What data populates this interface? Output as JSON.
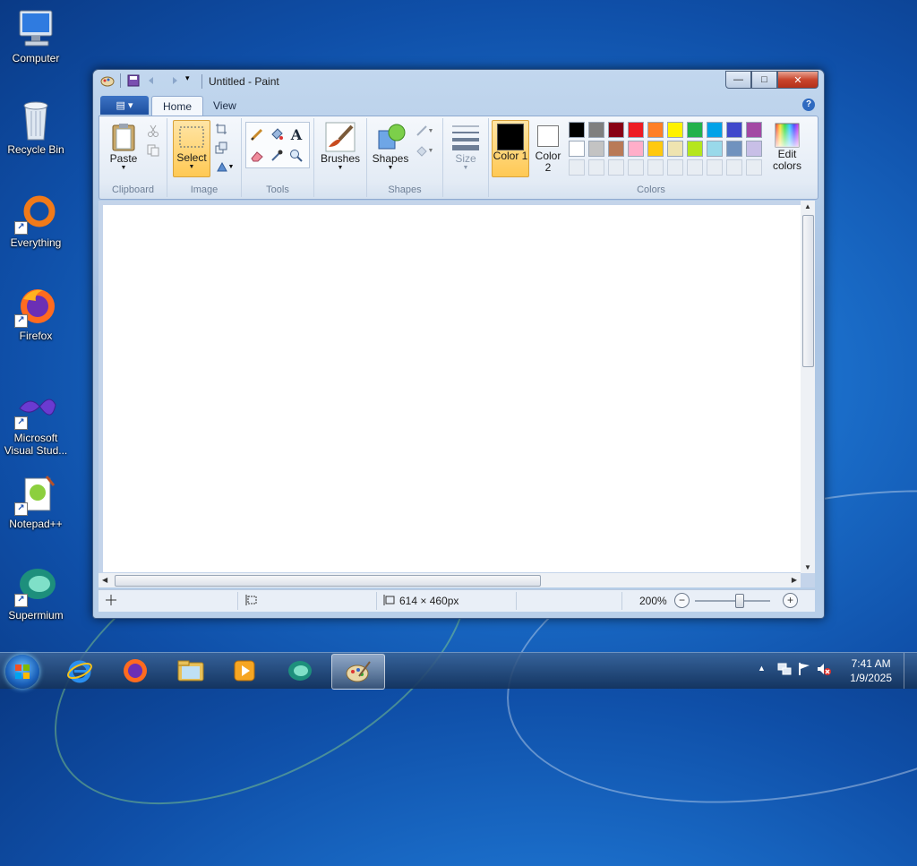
{
  "desktop": {
    "icons": [
      {
        "label": "Computer"
      },
      {
        "label": "Recycle Bin"
      },
      {
        "label": "Everything"
      },
      {
        "label": "Firefox"
      },
      {
        "label": "Microsoft Visual Stud..."
      },
      {
        "label": "Notepad++"
      },
      {
        "label": "Supermium"
      }
    ]
  },
  "window": {
    "title": "Untitled - Paint",
    "buttons": {
      "minimize": "—",
      "maximize": "□",
      "close": "✕"
    }
  },
  "ribbon": {
    "app_menu": "▤ ▾",
    "tabs": [
      "Home",
      "View"
    ],
    "help": "?",
    "groups": {
      "clipboard": {
        "label": "Clipboard",
        "paste": "Paste"
      },
      "image": {
        "label": "Image",
        "select": "Select"
      },
      "tools": {
        "label": "Tools"
      },
      "brushes": {
        "label": "Brushes"
      },
      "shapes": {
        "label": "Shapes",
        "shapes": "Shapes"
      },
      "size": {
        "label": "Size"
      },
      "colors": {
        "label": "Colors",
        "color1": "Color 1",
        "color2": "Color 2",
        "edit_colors": "Edit colors",
        "color1_value": "#000000",
        "color2_value": "#ffffff",
        "palette_row1": [
          "#000000",
          "#7f7f7f",
          "#880015",
          "#ed1c24",
          "#ff7f27",
          "#fff200",
          "#22b14c",
          "#00a2e8",
          "#3f48cc",
          "#a349a4"
        ],
        "palette_row2": [
          "#ffffff",
          "#c3c3c3",
          "#b97a57",
          "#ffaec9",
          "#ffc90e",
          "#efe4b0",
          "#b5e61d",
          "#99d9ea",
          "#7092be",
          "#c8bfe7"
        ]
      }
    }
  },
  "statusbar": {
    "dimensions": "614 × 460px",
    "zoom": "200%",
    "zoom_level_percent": 200
  },
  "taskbar": {
    "time": "7:41 AM",
    "date": "1/9/2025",
    "apps": [
      "internet-explorer",
      "firefox",
      "file-explorer",
      "media-player",
      "supermium",
      "paint"
    ]
  }
}
